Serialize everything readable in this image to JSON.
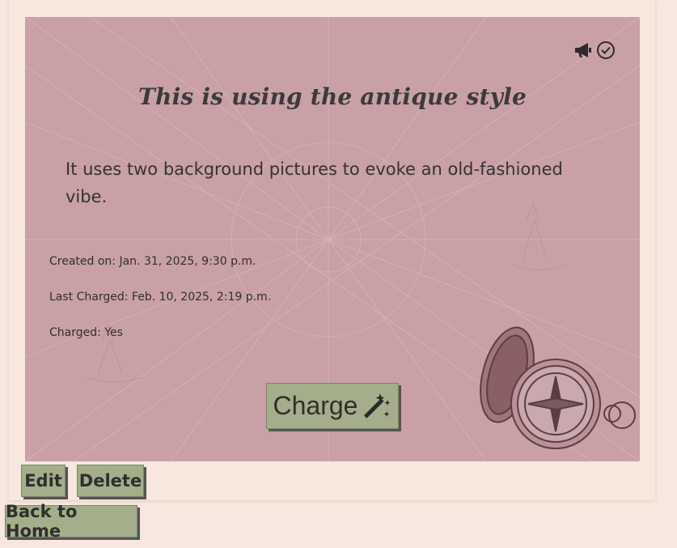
{
  "card": {
    "title": "This is using the antique style",
    "description": "It uses two background pictures to evoke an old-fashioned vibe.",
    "created": "Created on: Jan. 31, 2025, 9:30 p.m.",
    "last_charged": "Last Charged: Feb. 10, 2025, 2:19 p.m.",
    "charged": "Charged: Yes",
    "charge_label": "Charge",
    "icons": [
      "megaphone-icon",
      "check-circle-icon",
      "magic-wand-icon",
      "compass-illustration"
    ]
  },
  "actions": {
    "edit_label": "Edit",
    "delete_label": "Delete",
    "home_label": "Back to Home"
  },
  "colors": {
    "page_background": "#f7e7de",
    "card_background": "#c9a0a5",
    "button_background": "#a4ae8a",
    "text": "#2f2f2f"
  }
}
